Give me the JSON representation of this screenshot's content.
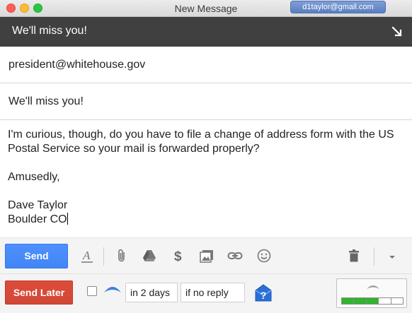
{
  "window": {
    "title": "New Message",
    "account": "d1taylor@gmail.com"
  },
  "compose": {
    "header_title": "We'll miss you!",
    "to": "president@whitehouse.gov",
    "subject": "We'll miss you!",
    "body_lines": [
      "I'm curious, though, do you have to file a change of address form with the US Postal Service so your mail is forwarded properly?",
      "",
      "Amusedly,",
      "",
      "Dave Taylor",
      "Boulder CO"
    ]
  },
  "toolbar": {
    "send_label": "Send",
    "icons": [
      "formatting-icon",
      "attach-icon",
      "drive-icon",
      "money-icon",
      "photo-icon",
      "link-icon",
      "emoji-icon",
      "trash-icon",
      "more-options-icon"
    ]
  },
  "boomerang": {
    "send_later_label": "Send Later",
    "delay": "in 2 days",
    "condition": "if no reply",
    "meter": {
      "segments_total": 5,
      "segments_filled": 3
    }
  },
  "colors": {
    "send_blue": "#4285f4",
    "send_later_red": "#d14836",
    "compose_bar": "#404040",
    "meter_green": "#2fb52f"
  }
}
